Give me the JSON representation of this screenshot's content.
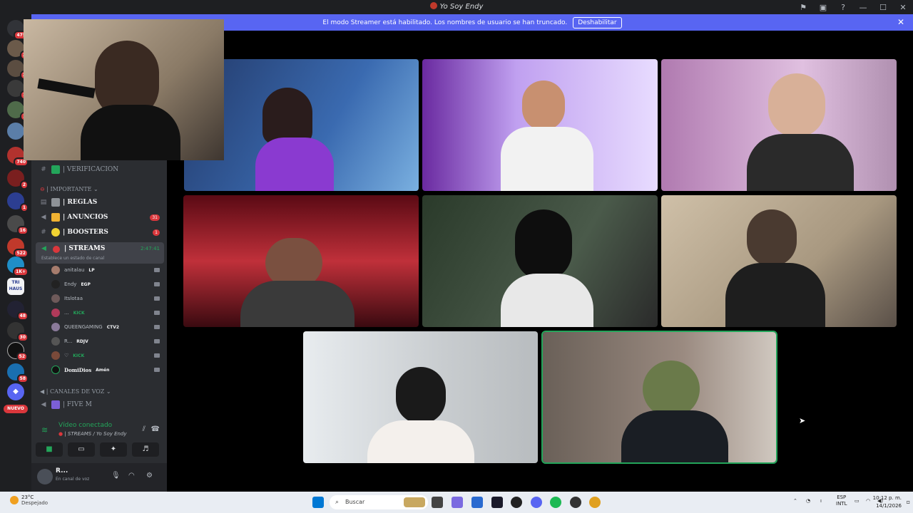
{
  "window": {
    "title": "Yo Soy Endy",
    "controls": [
      "—",
      "☐",
      "✕"
    ]
  },
  "banner": {
    "text": "El modo Streamer está habilitado. Los nombres de usuario se han truncado.",
    "button": "Deshabilitar"
  },
  "rail": {
    "badges": [
      "475",
      "2",
      "2",
      "1",
      "1",
      "2",
      "1",
      "740",
      "2",
      "1",
      "16",
      "522",
      "1K+",
      "",
      "48",
      "30",
      "52",
      "58"
    ],
    "nuevo": "NUEVO",
    "tri_haus": "TRI HAUS"
  },
  "sidebar": {
    "verificacion": "| VERIFICACION",
    "cat_importante": "| IMPORTANTE",
    "reglas": "| REGLAS",
    "anuncios": "| ANUNCIOS",
    "anuncios_count": "31",
    "boosters": "| BOOSTERS",
    "boosters_count": "1",
    "streams": "| STREAMS",
    "streams_status": "Establece un estado de canal",
    "streams_time": "2:47:41",
    "members": [
      {
        "name": "anitalau",
        "tag": "LP"
      },
      {
        "name": "Endy",
        "tag": "EGP"
      },
      {
        "name": "Itslotaa",
        "tag": ""
      },
      {
        "name": "...",
        "tag": "KICK"
      },
      {
        "name": "QUEENGAMING",
        "tag": "CTV2"
      },
      {
        "name": "R...",
        "tag": "RDJV"
      },
      {
        "name": "♡",
        "tag": "KICK"
      },
      {
        "name": "DomiDios",
        "tag": "Amén"
      }
    ],
    "cat_voz": "| CANALES DE VOZ",
    "five_m": "| FIVE M"
  },
  "voice": {
    "connected": "Vídeo conectado",
    "channel": "| STREAMS / Yo Soy Endy"
  },
  "user": {
    "name": "R...",
    "status": "En canal de voz"
  },
  "taskbar": {
    "temp": "23°C",
    "weather": "Despejado",
    "search": "Buscar",
    "lang1": "ESP",
    "lang2": "INTL",
    "time": "10:12 p. m.",
    "date": "14/1/2026"
  },
  "colors": {
    "blurple": "#5865f2",
    "green": "#23a55a",
    "red": "#da373c"
  }
}
